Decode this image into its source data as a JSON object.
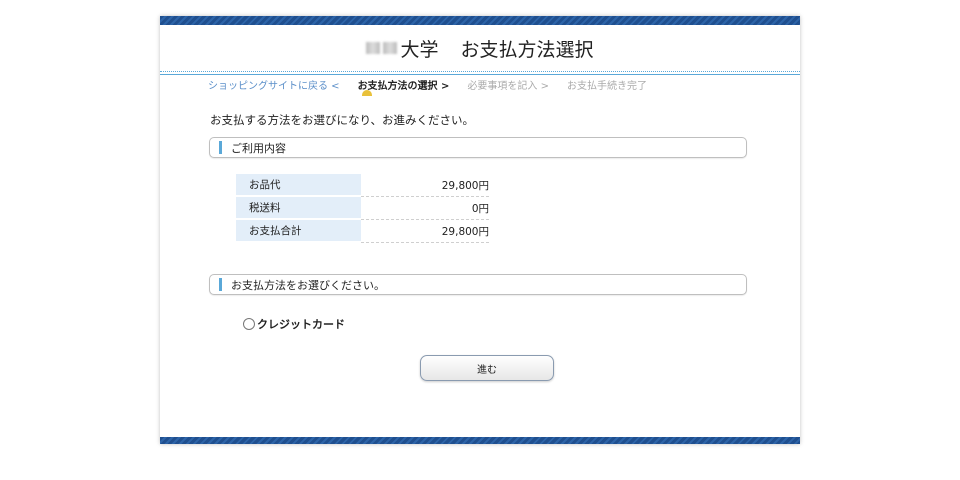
{
  "header": {
    "title_suffix": "大学",
    "title_main": "お支払方法選択"
  },
  "breadcrumb": {
    "back_link": "ショッピングサイトに戻る <",
    "current_step": "お支払方法の選択 >",
    "next_step": "必要事項を記入 >",
    "final_step": "お支払手続き完了"
  },
  "intro_text": "お支払する方法をお選びになり、お進みください。",
  "usage_section": {
    "heading": "ご利用内容",
    "rows": [
      {
        "label": "お品代",
        "value": "29,800円"
      },
      {
        "label": "税送料",
        "value": "0円"
      },
      {
        "label": "お支払合計",
        "value": "29,800円"
      }
    ]
  },
  "payment_section": {
    "heading": "お支払方法をお選びください。",
    "options": [
      {
        "label": "クレジットカード",
        "selected": false
      }
    ]
  },
  "proceed_button": "進む",
  "colors": {
    "accent": "#5aa8d8",
    "stripe": "#1f4f8f",
    "link": "#5b8fc9",
    "row_bg": "#e3eef9"
  }
}
